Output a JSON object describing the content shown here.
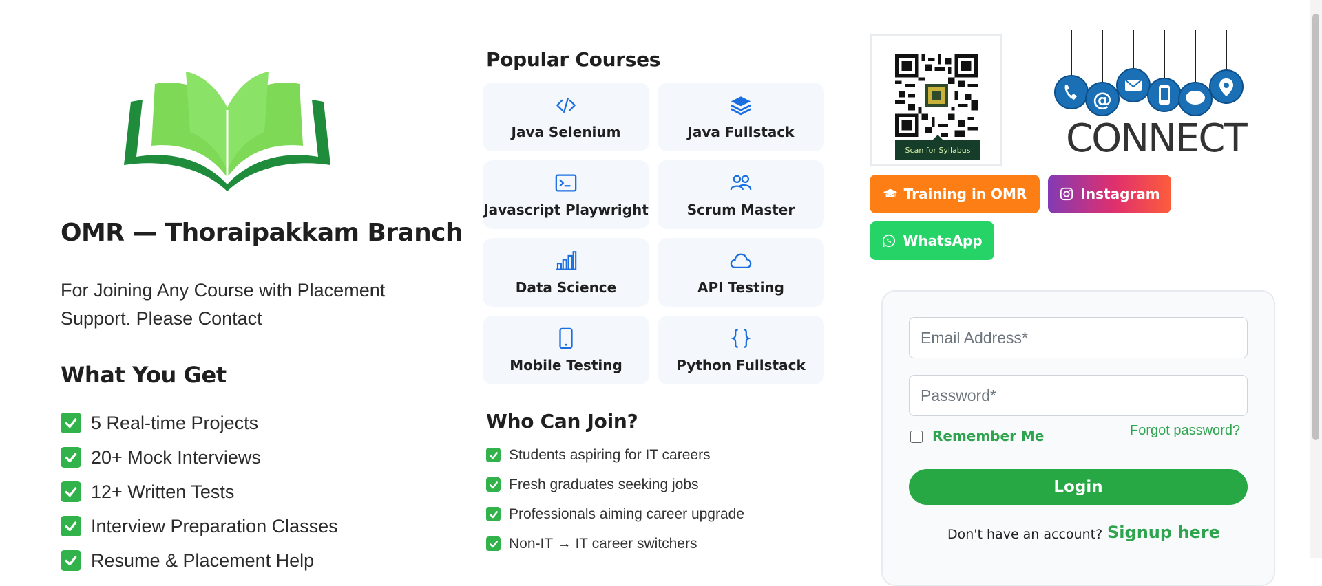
{
  "branch": {
    "title": "OMR — Thoraipakkam Branch",
    "contact_text": "For Joining Any Course with Placement Support. Please Contact"
  },
  "what_you_get": {
    "title": "What You Get",
    "items": [
      "5 Real-time Projects",
      "20+ Mock Interviews",
      "12+ Written Tests",
      "Interview Preparation Classes",
      "Resume & Placement Help"
    ]
  },
  "popular_courses": {
    "title": "Popular Courses",
    "items": [
      {
        "label": "Java Selenium",
        "icon": "code-icon"
      },
      {
        "label": "Java Fullstack",
        "icon": "layers-icon"
      },
      {
        "label": "Javascript Playwright",
        "icon": "terminal-icon"
      },
      {
        "label": "Scrum Master",
        "icon": "people-icon"
      },
      {
        "label": "Data Science",
        "icon": "bar-chart-icon"
      },
      {
        "label": "API Testing",
        "icon": "cloud-icon"
      },
      {
        "label": "Mobile Testing",
        "icon": "phone-icon"
      },
      {
        "label": "Python Fullstack",
        "icon": "braces-icon"
      }
    ]
  },
  "who_can_join": {
    "title": "Who Can Join?",
    "items": [
      "Students aspiring for IT careers",
      "Fresh graduates seeking jobs",
      "Professionals aiming career upgrade",
      "Non-IT → IT career switchers"
    ]
  },
  "qr": {
    "caption": "Scan for Syllabus"
  },
  "connect": {
    "word": "CONNECT"
  },
  "buttons": {
    "training": "Training in OMR",
    "instagram": "Instagram",
    "whatsapp": "WhatsApp"
  },
  "login": {
    "email_placeholder": "Email Address*",
    "password_placeholder": "Password*",
    "remember_label": "Remember Me",
    "forgot_label": "Forgot password?",
    "login_label": "Login",
    "no_account_text": "Don't have an account?",
    "signup_label": "Signup here"
  },
  "colors": {
    "accent_green": "#28a745",
    "link_green": "#2ea44f",
    "course_icon_blue": "#1a6ee0",
    "training_orange": "#fd7e14",
    "whatsapp_green": "#25d366"
  }
}
